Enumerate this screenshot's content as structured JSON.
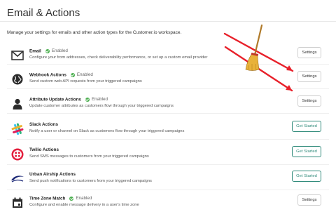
{
  "header": {
    "title": "Email & Actions",
    "description": "Manage your settings for emails and other action types for the Customer.io workspace."
  },
  "actions": [
    {
      "name": "Email",
      "status": "Enabled",
      "description": "Configure your from addresses, check deliverability performance, or set up a custom email provider",
      "button": "Settings",
      "icon": "envelope-icon"
    },
    {
      "name": "Webhook Actions",
      "status": "Enabled",
      "description": "Send custom web API requests from your triggered campaigns",
      "button": "Settings",
      "icon": "globe-icon"
    },
    {
      "name": "Attribute Update Actions",
      "status": "Enabled",
      "description": "Update customer attributes as customers flow through your triggered campaigns",
      "button": "Settings",
      "icon": "person-icon"
    },
    {
      "name": "Slack Actions",
      "status": "",
      "description": "Notify a user or channel on Slack as customers flow through your triggered campaigns",
      "button": "Get Started",
      "icon": "slack-logo-icon"
    },
    {
      "name": "Twilio Actions",
      "status": "",
      "description": "Send SMS messages to customers from your triggered campaigns",
      "button": "Get Started",
      "icon": "twilio-logo-icon"
    },
    {
      "name": "Urban Airship Actions",
      "status": "",
      "description": "Send push notifications to customers from your triggered campaigns",
      "button": "Get Started",
      "icon": "urban-airship-logo-icon"
    },
    {
      "name": "Time Zone Match",
      "status": "Enabled",
      "description": "Configure and enable message delivery in a user's time zone",
      "button": "Settings",
      "icon": "calendar-icon"
    }
  ],
  "colors": {
    "enabled": "#4caf50",
    "get_started": "#2f8a7a",
    "annotation": "#e8202a"
  }
}
